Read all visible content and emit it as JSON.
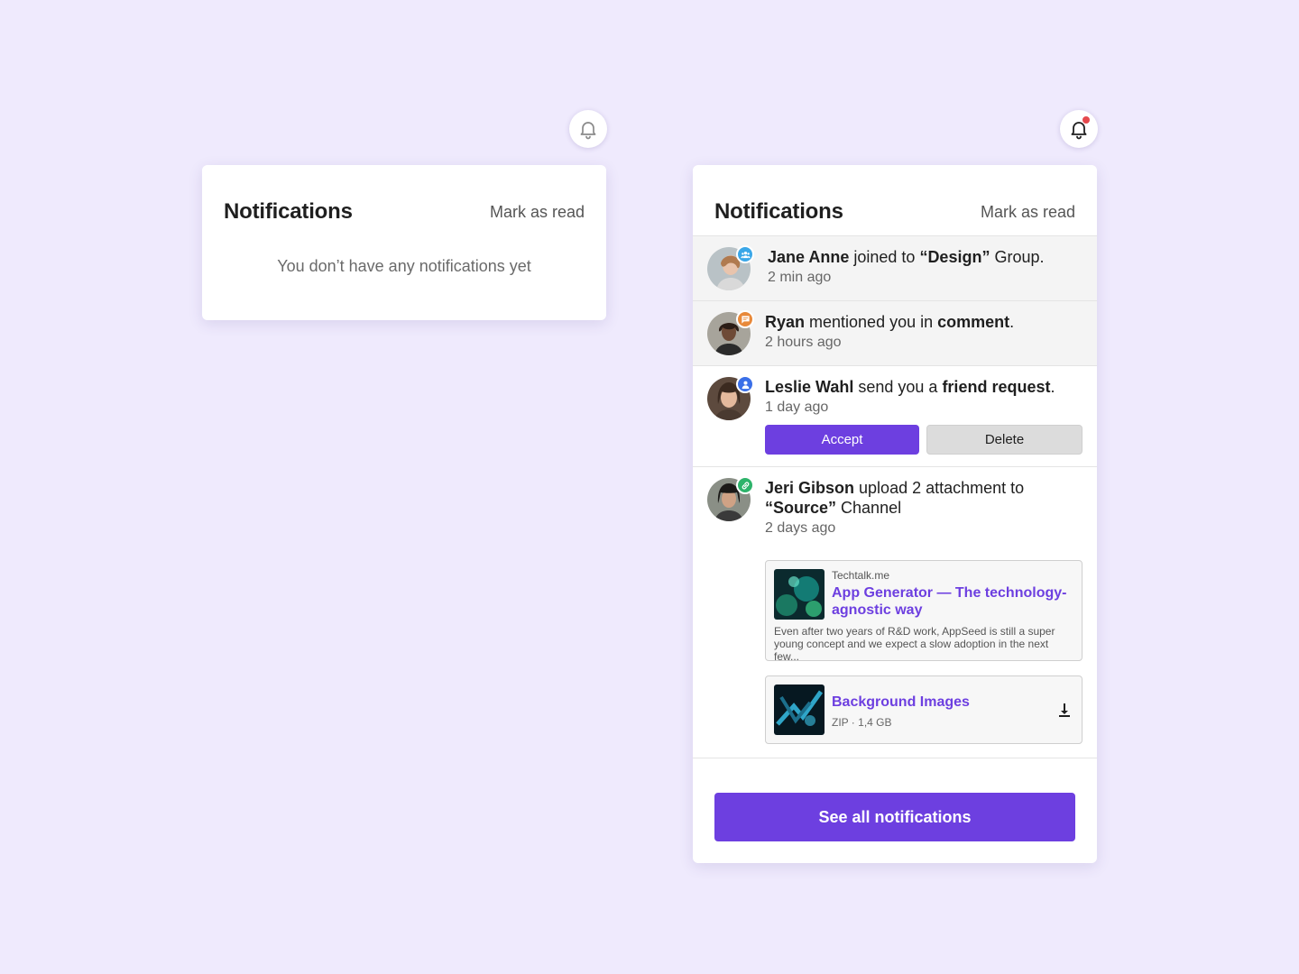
{
  "empty_panel": {
    "title": "Notifications",
    "mark_read": "Mark as read",
    "empty_message": "You don’t have any notifications yet"
  },
  "full_panel": {
    "title": "Notifications",
    "mark_read": "Mark as read",
    "notifications": [
      {
        "name": "Jane Anne",
        "action": " joined to ",
        "target": "“Design”",
        "suffix": " Group.",
        "time": "2 min ago",
        "badge_icon": "group-icon",
        "badge_color": "#3aa7e8",
        "unread": true
      },
      {
        "name": "Ryan",
        "action": " mentioned you in ",
        "target": "comment",
        "suffix": ".",
        "time": "2 hours ago",
        "badge_icon": "comment-icon",
        "badge_color": "#e8893a",
        "unread": true
      },
      {
        "name": "Leslie Wahl",
        "action": " send you a ",
        "target": "friend request",
        "suffix": ".",
        "time": "1 day ago",
        "badge_icon": "person-icon",
        "badge_color": "#3a6fe8",
        "accept_label": "Accept",
        "delete_label": "Delete",
        "unread": false
      },
      {
        "name": "Jeri Gibson",
        "action": " upload 2 attachment to ",
        "target": "“Source”",
        "suffix": " Channel",
        "time": "2 days ago",
        "badge_icon": "link-icon",
        "badge_color": "#2db36a",
        "unread": false,
        "link_card": {
          "domain": "Techtalk.me",
          "title": "App Generator — The technology-agnostic way",
          "description": "Even after two years of R&D work, AppSeed is still a super young concept and we expect a slow adoption in the next few..."
        },
        "file_card": {
          "title": "Background Images",
          "type": "ZIP",
          "separator": "·",
          "size": "1,4 GB"
        }
      }
    ],
    "see_all_label": "See all notifications"
  },
  "colors": {
    "background": "#efeafd",
    "accent": "#6d3fe0",
    "alert_dot": "#e5484d"
  }
}
